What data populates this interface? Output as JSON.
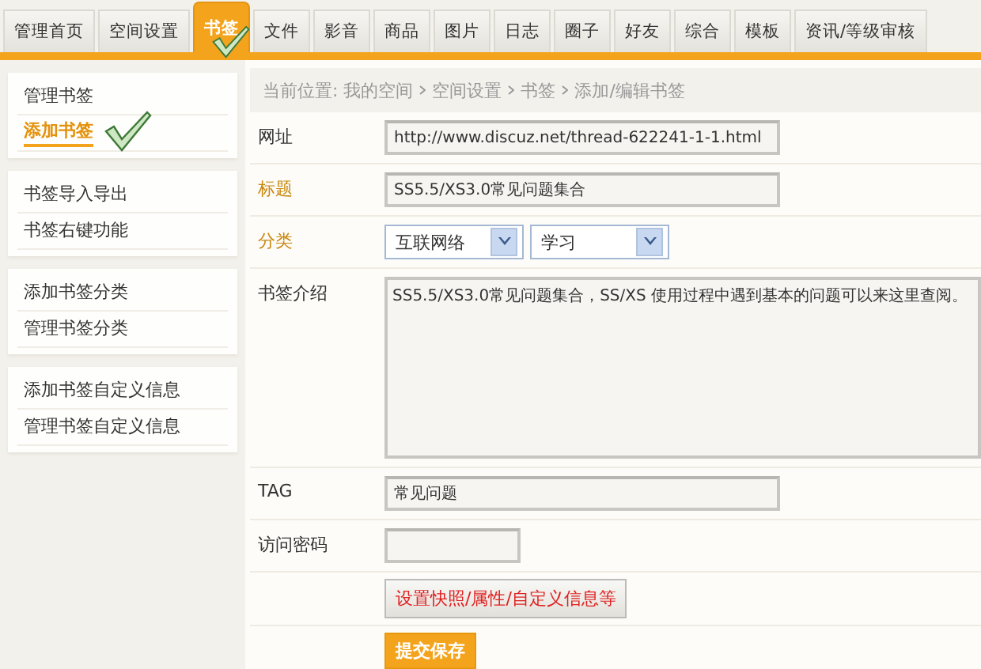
{
  "tabs": [
    {
      "label": "管理首页",
      "selected": false
    },
    {
      "label": "空间设置",
      "selected": false
    },
    {
      "label": "书签",
      "selected": true
    },
    {
      "label": "文件",
      "selected": false
    },
    {
      "label": "影音",
      "selected": false
    },
    {
      "label": "商品",
      "selected": false
    },
    {
      "label": "图片",
      "selected": false
    },
    {
      "label": "日志",
      "selected": false
    },
    {
      "label": "圈子",
      "selected": false
    },
    {
      "label": "好友",
      "selected": false
    },
    {
      "label": "综合",
      "selected": false
    },
    {
      "label": "模板",
      "selected": false
    },
    {
      "label": "资讯/等级审核",
      "selected": false
    }
  ],
  "sidebar": {
    "groups": [
      {
        "items": [
          {
            "label": "管理书签",
            "selected": false
          },
          {
            "label": "添加书签",
            "selected": true
          }
        ]
      },
      {
        "items": [
          {
            "label": "书签导入导出",
            "selected": false
          },
          {
            "label": "书签右键功能",
            "selected": false
          }
        ]
      },
      {
        "items": [
          {
            "label": "添加书签分类",
            "selected": false
          },
          {
            "label": "管理书签分类",
            "selected": false
          }
        ]
      },
      {
        "items": [
          {
            "label": "添加书签自定义信息",
            "selected": false
          },
          {
            "label": "管理书签自定义信息",
            "selected": false
          }
        ]
      }
    ]
  },
  "breadcrumb": [
    "当前位置: 我的空间",
    "空间设置",
    "书签",
    "添加/编辑书签"
  ],
  "form": {
    "fields": [
      {
        "kind": "text",
        "label": "网址",
        "required": false,
        "value": "http://www.discuz.net/thread-622241-1-1.html"
      },
      {
        "kind": "text",
        "label": "标题",
        "required": true,
        "value": "SS5.5/XS3.0常见问题集合"
      },
      {
        "kind": "selects",
        "label": "分类",
        "required": true,
        "values": [
          "互联网络",
          "学习"
        ]
      },
      {
        "kind": "textarea",
        "label": "书签介绍",
        "required": false,
        "value": "SS5.5/XS3.0常见问题集合，SS/XS 使用过程中遇到基本的问题可以来这里查阅。"
      },
      {
        "kind": "text",
        "label": "TAG",
        "required": false,
        "value": "常见问题"
      },
      {
        "kind": "short",
        "label": "访问密码",
        "required": false
      }
    ],
    "options_button": "设置快照/属性/自定义信息等",
    "submit_button": "提交保存"
  }
}
